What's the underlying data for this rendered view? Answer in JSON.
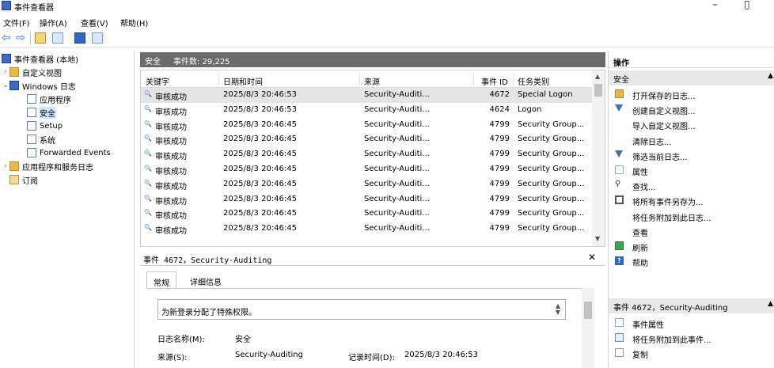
{
  "window": {
    "title": "事件查看器",
    "minimize": "–",
    "maximize": "▯"
  },
  "menu": [
    "文件(F)",
    "操作(A)",
    "查看(V)",
    "帮助(H)"
  ],
  "tree": {
    "items": [
      {
        "label": "事件查看器 (本地)",
        "expander": "",
        "icon": "event-viewer-icon"
      },
      {
        "label": "自定义视图",
        "expander": "›",
        "icon": "folder-icon"
      },
      {
        "label": "Windows 日志",
        "expander": "⌄",
        "icon": "folder-icon"
      },
      {
        "label": "应用程序",
        "expander": "",
        "icon": "log-icon"
      },
      {
        "label": "安全",
        "expander": "",
        "icon": "log-icon"
      },
      {
        "label": "Setup",
        "expander": "",
        "icon": "log-icon"
      },
      {
        "label": "系统",
        "expander": "",
        "icon": "log-icon"
      },
      {
        "label": "Forwarded Events",
        "expander": "",
        "icon": "log-icon"
      },
      {
        "label": "应用程序和服务日志",
        "expander": "›",
        "icon": "folder-icon"
      },
      {
        "label": "订阅",
        "expander": "",
        "icon": "subscription-icon"
      }
    ],
    "selected_index": 4
  },
  "events": {
    "log_name": "安全",
    "count_label": "事件数: 29,225",
    "columns": [
      "关键字",
      "日期和时间",
      "来源",
      "事件 ID",
      "任务类别"
    ],
    "rows": [
      {
        "keyword": "审核成功",
        "datetime": "2025/8/3 20:46:53",
        "source": "Security-Auditi...",
        "event_id": "4672",
        "category": "Special Logon"
      },
      {
        "keyword": "审核成功",
        "datetime": "2025/8/3 20:46:53",
        "source": "Security-Auditi...",
        "event_id": "4624",
        "category": "Logon"
      },
      {
        "keyword": "审核成功",
        "datetime": "2025/8/3 20:46:45",
        "source": "Security-Auditi...",
        "event_id": "4799",
        "category": "Security Group..."
      },
      {
        "keyword": "审核成功",
        "datetime": "2025/8/3 20:46:45",
        "source": "Security-Auditi...",
        "event_id": "4799",
        "category": "Security Group..."
      },
      {
        "keyword": "审核成功",
        "datetime": "2025/8/3 20:46:45",
        "source": "Security-Auditi...",
        "event_id": "4799",
        "category": "Security Group..."
      },
      {
        "keyword": "审核成功",
        "datetime": "2025/8/3 20:46:45",
        "source": "Security-Auditi...",
        "event_id": "4799",
        "category": "Security Group..."
      },
      {
        "keyword": "审核成功",
        "datetime": "2025/8/3 20:46:45",
        "source": "Security-Auditi...",
        "event_id": "4799",
        "category": "Security Group..."
      },
      {
        "keyword": "审核成功",
        "datetime": "2025/8/3 20:46:45",
        "source": "Security-Auditi...",
        "event_id": "4799",
        "category": "Security Group..."
      },
      {
        "keyword": "审核成功",
        "datetime": "2025/8/3 20:46:45",
        "source": "Security-Auditi...",
        "event_id": "4799",
        "category": "Security Group..."
      },
      {
        "keyword": "审核成功",
        "datetime": "2025/8/3 20:46:45",
        "source": "Security-Auditi...",
        "event_id": "4799",
        "category": "Security Group..."
      }
    ],
    "selected_index": 0
  },
  "detail": {
    "title": "事件 4672，Security-Auditing",
    "tabs": [
      "常规",
      "详细信息"
    ],
    "description": "为新登录分配了特殊权限。",
    "log_name_label": "日志名称(M):",
    "log_name_value": "安全",
    "source_label": "来源(S):",
    "source_value": "Security-Auditing",
    "logged_label": "记录时间(D):",
    "logged_value": "2025/8/3 20:46:53"
  },
  "actions": {
    "title": "操作",
    "section1": "安全",
    "items1": [
      {
        "label": "打开保存的日志...",
        "icon": "open-log-icon"
      },
      {
        "label": "创建自定义视图...",
        "icon": "filter-icon"
      },
      {
        "label": "导入自定义视图...",
        "icon": ""
      },
      {
        "label": "清除日志...",
        "icon": ""
      },
      {
        "label": "筛选当前日志...",
        "icon": "filter-icon"
      },
      {
        "label": "属性",
        "icon": "properties-icon"
      },
      {
        "label": "查找...",
        "icon": "find-icon"
      },
      {
        "label": "将所有事件另存为...",
        "icon": "save-icon"
      },
      {
        "label": "将任务附加到此日志...",
        "icon": ""
      },
      {
        "label": "查看",
        "icon": ""
      },
      {
        "label": "刷新",
        "icon": "refresh-icon"
      },
      {
        "label": "帮助",
        "icon": "help-icon"
      }
    ],
    "section2": "事件 4672，Security-Auditing",
    "items2": [
      {
        "label": "事件属性",
        "icon": "event-properties-icon"
      },
      {
        "label": "将任务附加到此事件...",
        "icon": "task-icon"
      },
      {
        "label": "复制",
        "icon": "copy-icon"
      }
    ]
  }
}
